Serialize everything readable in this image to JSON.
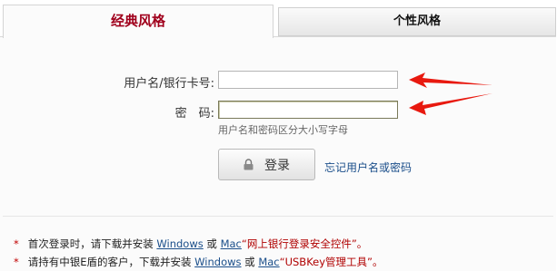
{
  "tabs": {
    "classic": "经典风格",
    "personal": "个性风格"
  },
  "form": {
    "username_label": "用户名/银行卡号:",
    "password_label": "密　码:",
    "username_value": "",
    "password_value": "",
    "hint": "用户名和密码区分大小写字母",
    "login_button": "登录",
    "forgot_link": "忘记用户名或密码"
  },
  "notices": [
    {
      "star": "*",
      "prefix": "首次登录时，请下载并安装",
      "link1": "Windows",
      "or": "或",
      "link2": "Mac",
      "suffix": "“网上银行登录安全控件”。"
    },
    {
      "star": "*",
      "prefix": "请持有中银E盾的客户，下载并安装",
      "link1": "Windows",
      "or": "或",
      "link2": "Mac",
      "suffix": "“USBKey管理工具”。"
    }
  ],
  "colors": {
    "active_tab": "#a0001c",
    "link": "#1a4e8a",
    "arrow": "#e8190f",
    "star": "#c00000"
  },
  "icons": {
    "login_button_icon": "lock-icon",
    "annotation": "red-arrow-icon"
  }
}
